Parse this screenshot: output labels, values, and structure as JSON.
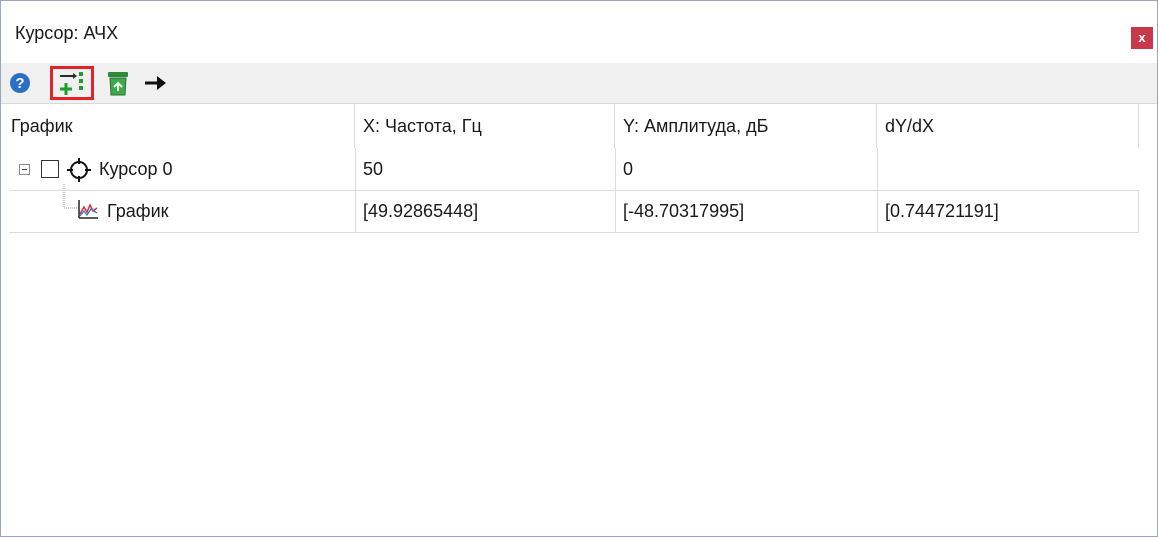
{
  "window": {
    "title": "Курсор: АЧХ",
    "close_label": "x"
  },
  "toolbar": {
    "buttons": [
      {
        "name": "help-icon"
      },
      {
        "name": "add-cursor-icon"
      },
      {
        "name": "delete-icon"
      },
      {
        "name": "arrow-right-icon"
      }
    ]
  },
  "table": {
    "columns": [
      "График",
      "X: Частота, Гц",
      "Y: Амплитуда, дБ",
      "dY/dX"
    ],
    "rows": [
      {
        "label": "Курсор 0",
        "x": "50",
        "y": "0",
        "dydx": ""
      },
      {
        "label": "График",
        "x": "[49.92865448]",
        "y": "[-48.70317995]",
        "dydx": "[0.744721191]"
      }
    ]
  },
  "colors": {
    "close_bg": "#c9384a",
    "highlight_border": "#e3232a"
  }
}
